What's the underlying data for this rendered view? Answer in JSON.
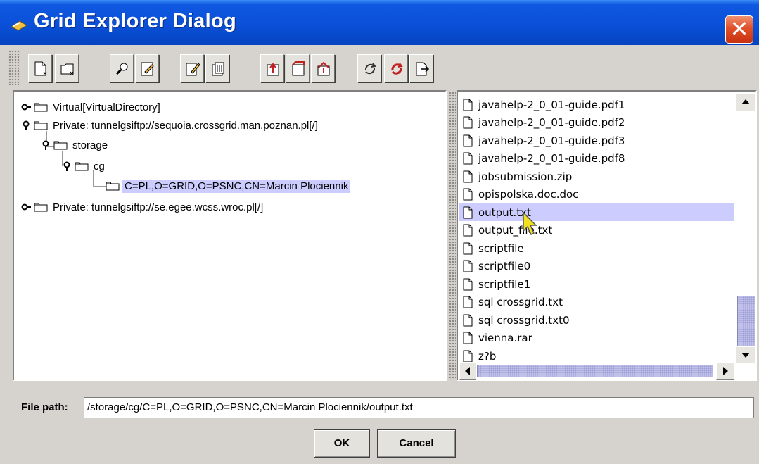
{
  "window": {
    "title": "Grid Explorer Dialog",
    "close_glyph": "✕",
    "accent": "#0a50d8"
  },
  "toolbar": {
    "buttons": [
      {
        "icon": "new-file-icon"
      },
      {
        "icon": "new-folder-icon"
      },
      {
        "icon": "search-icon"
      },
      {
        "icon": "edit-icon"
      },
      {
        "icon": "rename-icon"
      },
      {
        "icon": "delete-icon"
      },
      {
        "icon": "folder-up-icon"
      },
      {
        "icon": "folder-icon"
      },
      {
        "icon": "folder-home-icon"
      },
      {
        "icon": "refresh-icon"
      },
      {
        "icon": "stop-icon"
      },
      {
        "icon": "properties-icon"
      }
    ]
  },
  "tree": {
    "nodes": [
      {
        "label": "Virtual[VirtualDirectory]"
      },
      {
        "label": "Private: tunnelgsiftp://sequoia.crossgrid.man.poznan.pl[/]"
      },
      {
        "label": "storage"
      },
      {
        "label": "cg"
      },
      {
        "label": "C=PL,O=GRID,O=PSNC,CN=Marcin Plociennik",
        "selected": true
      },
      {
        "label": "Private: tunnelgsiftp://se.egee.wcss.wroc.pl[/]"
      }
    ]
  },
  "files": {
    "items": [
      "javahelp-2_0_01-guide.pdf1",
      "javahelp-2_0_01-guide.pdf2",
      "javahelp-2_0_01-guide.pdf3",
      "javahelp-2_0_01-guide.pdf8",
      "jobsubmission.zip",
      "opispolska.doc.doc",
      "output.txt",
      "output_file.txt",
      "scriptfile",
      "scriptfile0",
      "scriptfile1",
      "sql crossgrid.txt",
      "sql crossgrid.txt0",
      "vienna.rar",
      "z?b"
    ],
    "selected_index": 6
  },
  "path": {
    "label": "File path:",
    "value": "/storage/cg/C=PL,O=GRID,O=PSNC,CN=Marcin Plociennik/output.txt"
  },
  "buttons": {
    "ok": "OK",
    "cancel": "Cancel"
  },
  "colors": {
    "selection": "#ccccff",
    "dialog_bg": "#d6d3ce"
  }
}
